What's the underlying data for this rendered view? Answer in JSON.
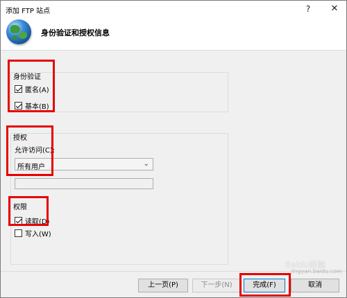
{
  "window": {
    "title": "添加 FTP 站点",
    "help_glyph": "?",
    "close_glyph": "✕"
  },
  "header": {
    "title": "身份验证和授权信息",
    "icon": "globe-icon"
  },
  "auth": {
    "legend": "身份验证",
    "options": [
      {
        "label": "匿名(A)",
        "checked": true
      },
      {
        "label": "基本(B)",
        "checked": true
      }
    ]
  },
  "authz": {
    "legend": "授权",
    "access_label": "允许访问(C):",
    "access_selected": "所有用户",
    "access_textbox_value": "",
    "perm_legend": "权限",
    "perms": [
      {
        "label": "读取(D)",
        "checked": true
      },
      {
        "label": "写入(W)",
        "checked": false
      }
    ]
  },
  "buttons": {
    "prev": "上一页(P)",
    "next": "下一步(N)",
    "finish": "完成(F)",
    "cancel": "取消"
  },
  "watermark": {
    "text": "Baidu经验",
    "sub": "jingyan.baidu.com"
  },
  "colors": {
    "highlight": "#e60000",
    "focus": "#0078d7"
  }
}
